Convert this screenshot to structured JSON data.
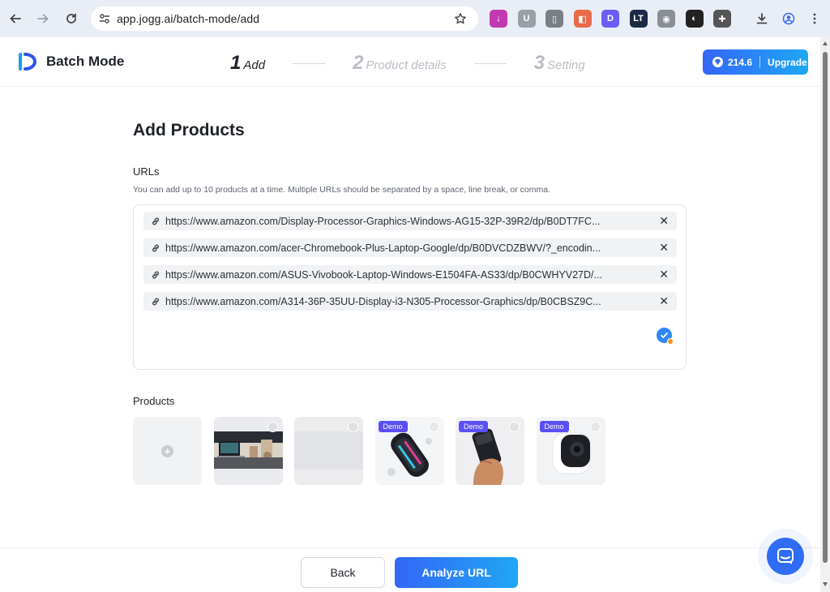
{
  "browser": {
    "url": "app.jogg.ai/batch-mode/add",
    "extensions": [
      {
        "name": "download-ext-icon",
        "color": "#c239b3",
        "glyph": "↓"
      },
      {
        "name": "u-ext-icon",
        "color": "#9aa0a6",
        "glyph": "U"
      },
      {
        "name": "mouse-ext-icon",
        "color": "#7a7f86",
        "glyph": "▯"
      },
      {
        "name": "scribe-ext-icon",
        "color": "#e86b4a",
        "glyph": "◧"
      },
      {
        "name": "d-ext-icon",
        "color": "#6a5cf5",
        "glyph": "D"
      },
      {
        "name": "lt-ext-icon",
        "color": "#1c2b45",
        "glyph": "LT"
      },
      {
        "name": "camera-ext-icon",
        "color": "#8a8f96",
        "glyph": "◉"
      },
      {
        "name": "halfcircle-ext-icon",
        "color": "#222222",
        "glyph": "◐"
      },
      {
        "name": "puzzle-ext-icon",
        "color": "#555555",
        "glyph": "✚"
      }
    ]
  },
  "header": {
    "app_title": "Batch Mode",
    "steps": [
      {
        "num": "1",
        "label": "Add",
        "state": "active"
      },
      {
        "num": "2",
        "label": "Product details",
        "state": "inactive"
      },
      {
        "num": "3",
        "label": "Setting",
        "state": "inactive"
      }
    ],
    "credits": "214.6",
    "upgrade_label": "Upgrade"
  },
  "main": {
    "title": "Add Products",
    "urls_label": "URLs",
    "urls_hint": "You can add up to 10 products at a time. Multiple URLs should be separated by a space, line break, or comma.",
    "urls": [
      "https://www.amazon.com/Display-Processor-Graphics-Windows-AG15-32P-39R2/dp/B0DT7FC...",
      "https://www.amazon.com/acer-Chromebook-Plus-Laptop-Google/dp/B0DVCDZBWV/?_encodin...",
      "https://www.amazon.com/ASUS-Vivobook-Laptop-Windows-E1504FA-AS33/dp/B0CWHYV27D/...",
      "https://www.amazon.com/A314-36P-35UU-Display-i3-N305-Processor-Graphics/dp/B0CBSZ9C..."
    ],
    "products_label": "Products",
    "products": [
      {
        "kind": "add"
      },
      {
        "kind": "image",
        "subject": "laptop-desk",
        "demo": false
      },
      {
        "kind": "image",
        "subject": "blank",
        "demo": false
      },
      {
        "kind": "image",
        "subject": "speaker",
        "demo": true,
        "badge": "Demo"
      },
      {
        "kind": "image",
        "subject": "phone-hand",
        "demo": true,
        "badge": "Demo"
      },
      {
        "kind": "image",
        "subject": "security-camera",
        "demo": true,
        "badge": "Demo"
      }
    ]
  },
  "footer": {
    "back_label": "Back",
    "analyze_label": "Analyze URL"
  }
}
